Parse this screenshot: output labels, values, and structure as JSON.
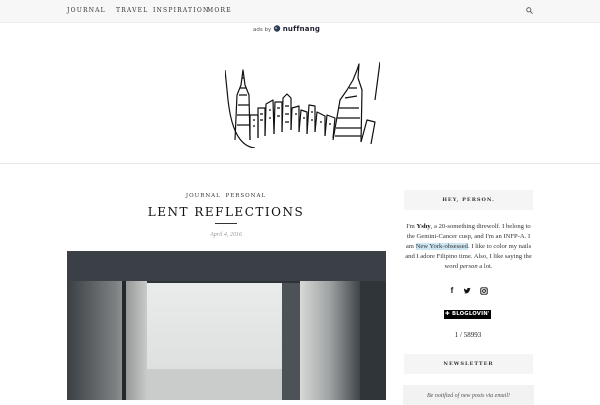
{
  "nav": {
    "journal": "JOURNAL",
    "travel": "TRAVEL",
    "inspiration": "INSPIRATION",
    "more": "MORE"
  },
  "ads": {
    "prefix": "ads by",
    "brand": "nuffnang"
  },
  "post": {
    "category_1": "JOURNAL",
    "category_2": "PERSONAL",
    "title": "LENT REFLECTIONS",
    "date": "April 4, 2016"
  },
  "sidebar": {
    "about_heading": "HEY, PERSON.",
    "about": {
      "t1": "I'm ",
      "name": "Yshy",
      "t2": ", a 20-something direwolf. I belong to the Gemini-Cancer cusp, and I'm an INFP-A. I am ",
      "highlight": "New York-obsessed",
      "t3": ". I like to color my nails and I adore Filipino time. Also, I like saying the word ",
      "word": "person",
      "t4": " a lot."
    },
    "social_icons": [
      "facebook-icon",
      "twitter-icon",
      "instagram-icon"
    ],
    "bloglovin_label": "✚ BLOGLOVIN'",
    "follower_count": "1 / 58993",
    "newsletter_heading": "NEWSLETTER",
    "newsletter_text": "Be notified of new posts via email!"
  },
  "colors": {
    "highlight": "#cde6f2",
    "nav_bg": "#f7f7f7",
    "widget_bg": "#f5f5f5"
  }
}
